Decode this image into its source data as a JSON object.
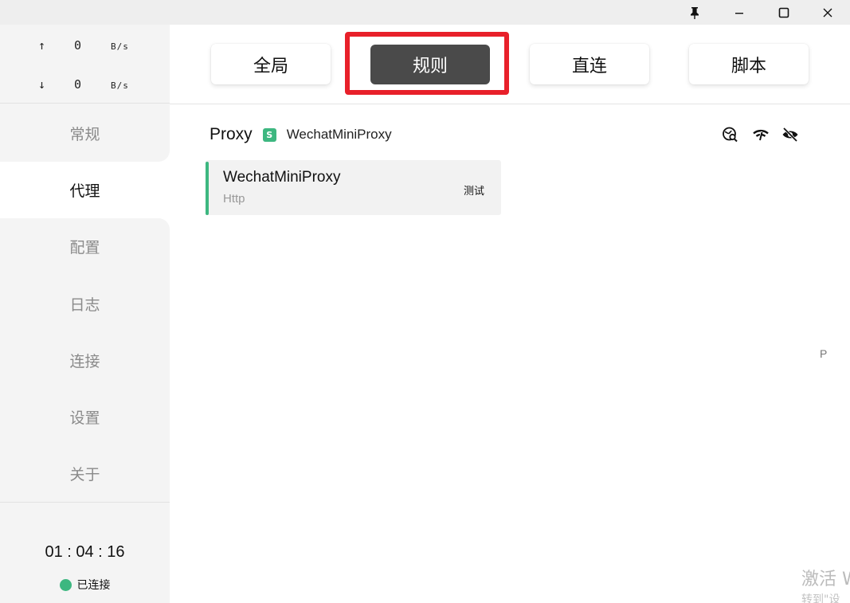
{
  "window": {
    "pin_icon": "pin-icon",
    "minimize_icon": "minimize-icon",
    "maximize_icon": "maximize-icon",
    "close_icon": "close-icon"
  },
  "speed": {
    "up_arrow": "↑",
    "up_value": "0",
    "up_unit": "B/s",
    "down_arrow": "↓",
    "down_value": "0",
    "down_unit": "B/s"
  },
  "sidebar": {
    "items": [
      {
        "label": "常规",
        "active": false
      },
      {
        "label": "代理",
        "active": true
      },
      {
        "label": "配置",
        "active": false
      },
      {
        "label": "日志",
        "active": false
      },
      {
        "label": "连接",
        "active": false
      },
      {
        "label": "设置",
        "active": false
      },
      {
        "label": "关于",
        "active": false
      }
    ],
    "timer": "01 : 04 : 16",
    "status": "已连接"
  },
  "modes": {
    "items": [
      {
        "label": "全局",
        "selected": false
      },
      {
        "label": "规则",
        "selected": true
      },
      {
        "label": "直连",
        "selected": false
      },
      {
        "label": "脚本",
        "selected": false
      }
    ]
  },
  "proxy_group": {
    "title": "Proxy",
    "badge": "S",
    "selected": "WechatMiniProxy",
    "header_icons": [
      "latency-test-icon",
      "wifi-icon",
      "hide-icon"
    ]
  },
  "proxy_card": {
    "name": "WechatMiniProxy",
    "type": "Http",
    "test_label": "测试"
  },
  "edge_letter": "P",
  "watermark": {
    "line1": "激活 W",
    "line2": "转到\"设"
  },
  "colors": {
    "accent": "#3db780",
    "selected_mode": "#4a4a4a",
    "highlight": "#e8202a"
  }
}
